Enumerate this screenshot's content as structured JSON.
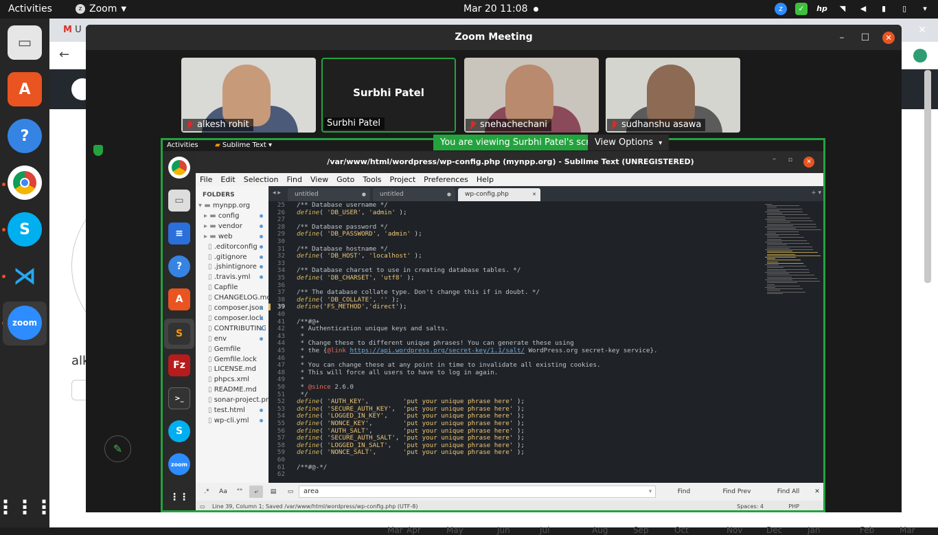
{
  "topbar": {
    "activities": "Activities",
    "app_name": "Zoom",
    "clock": "Mar 20  11:08"
  },
  "browser": {
    "tab_fragment": "U",
    "user_fragment": "alk",
    "calendar_months": [
      "Mar",
      "Apr",
      "May",
      "Jun",
      "Jul",
      "Aug",
      "Sep",
      "Oct",
      "Nov",
      "Dec",
      "Jan",
      "Feb",
      "Mar"
    ]
  },
  "zoom": {
    "title": "Zoom Meeting",
    "participants": [
      {
        "name": "alkesh rohit",
        "muted": true
      },
      {
        "name": "Surbhi Patel",
        "muted": false,
        "active_speaker": true
      },
      {
        "name": "snehachechani",
        "muted": true
      },
      {
        "name": "sudhanshu asawa",
        "muted": true
      }
    ],
    "share_banner": "You are viewing Surbhi Patel's screen",
    "view_options": "View Options"
  },
  "shared_screen": {
    "topbar": {
      "activities": "Activities",
      "app": "Sublime Text"
    },
    "sublime": {
      "title": "/var/www/html/wordpress/wp-config.php (mynpp.org) - Sublime Text (UNREGISTERED)",
      "menu": [
        "File",
        "Edit",
        "Selection",
        "Find",
        "View",
        "Goto",
        "Tools",
        "Project",
        "Preferences",
        "Help"
      ],
      "sidebar_header": "FOLDERS",
      "sidebar_items": [
        {
          "label": "mynpp.org",
          "type": "folder-open"
        },
        {
          "label": "config",
          "type": "folder"
        },
        {
          "label": "vendor",
          "type": "folder"
        },
        {
          "label": "web",
          "type": "folder"
        },
        {
          "label": ".editorconfig",
          "type": "file"
        },
        {
          "label": ".gitignore",
          "type": "file"
        },
        {
          "label": ".jshintignore",
          "type": "file"
        },
        {
          "label": ".travis.yml",
          "type": "file"
        },
        {
          "label": "Capfile",
          "type": "file"
        },
        {
          "label": "CHANGELOG.md",
          "type": "file"
        },
        {
          "label": "composer.json",
          "type": "file"
        },
        {
          "label": "composer.lock",
          "type": "file"
        },
        {
          "label": "CONTRIBUTING.md",
          "type": "file"
        },
        {
          "label": "env",
          "type": "file"
        },
        {
          "label": "Gemfile",
          "type": "file"
        },
        {
          "label": "Gemfile.lock",
          "type": "file"
        },
        {
          "label": "LICENSE.md",
          "type": "file"
        },
        {
          "label": "phpcs.xml",
          "type": "file"
        },
        {
          "label": "README.md",
          "type": "file"
        },
        {
          "label": "sonar-project.properties",
          "type": "file"
        },
        {
          "label": "test.html",
          "type": "file"
        },
        {
          "label": "wp-cli.yml",
          "type": "file"
        }
      ],
      "tabs": [
        {
          "label": "untitled",
          "active": false
        },
        {
          "label": "untitled",
          "active": false
        },
        {
          "label": "wp-config.php",
          "active": true
        }
      ],
      "code_lines": [
        {
          "n": "25",
          "t": "/** Database username */",
          "k": "com"
        },
        {
          "n": "26",
          "t": "define( 'DB_USER', 'admin' );",
          "k": "def"
        },
        {
          "n": "27",
          "t": "",
          "k": "pl"
        },
        {
          "n": "28",
          "t": "/** Database password */",
          "k": "com"
        },
        {
          "n": "29",
          "t": "define( 'DB_PASSWORD', 'admin' );",
          "k": "def"
        },
        {
          "n": "30",
          "t": "",
          "k": "pl"
        },
        {
          "n": "31",
          "t": "/** Database hostname */",
          "k": "com"
        },
        {
          "n": "32",
          "t": "define( 'DB_HOST', 'localhost' );",
          "k": "def"
        },
        {
          "n": "33",
          "t": "",
          "k": "pl"
        },
        {
          "n": "34",
          "t": "/** Database charset to use in creating database tables. */",
          "k": "com"
        },
        {
          "n": "35",
          "t": "define( 'DB_CHARSET', 'utf8' );",
          "k": "def"
        },
        {
          "n": "36",
          "t": "",
          "k": "pl"
        },
        {
          "n": "37",
          "t": "/** The database collate type. Don't change this if in doubt. */",
          "k": "com"
        },
        {
          "n": "38",
          "t": "define( 'DB_COLLATE', '' );",
          "k": "def"
        },
        {
          "n": "39",
          "t": "define('FS_METHOD','direct');",
          "k": "def"
        },
        {
          "n": "40",
          "t": "",
          "k": "pl"
        },
        {
          "n": "41",
          "t": "/**#@+",
          "k": "com"
        },
        {
          "n": "42",
          "t": " * Authentication unique keys and salts.",
          "k": "com"
        },
        {
          "n": "43",
          "t": " *",
          "k": "com"
        },
        {
          "n": "44",
          "t": " * Change these to different unique phrases! You can generate these using",
          "k": "com"
        },
        {
          "n": "45",
          "t": " * the {@link https://api.wordpress.org/secret-key/1.1/salt/ WordPress.org secret-key service}.",
          "k": "link"
        },
        {
          "n": "46",
          "t": " *",
          "k": "com"
        },
        {
          "n": "47",
          "t": " * You can change these at any point in time to invalidate all existing cookies.",
          "k": "com"
        },
        {
          "n": "48",
          "t": " * This will force all users to have to log in again.",
          "k": "com"
        },
        {
          "n": "49",
          "t": " *",
          "k": "com"
        },
        {
          "n": "50",
          "t": " * @since 2.6.0",
          "k": "since"
        },
        {
          "n": "51",
          "t": " */",
          "k": "com"
        },
        {
          "n": "52",
          "t": "define( 'AUTH_KEY',         'put your unique phrase here' );",
          "k": "def"
        },
        {
          "n": "53",
          "t": "define( 'SECURE_AUTH_KEY',  'put your unique phrase here' );",
          "k": "def"
        },
        {
          "n": "54",
          "t": "define( 'LOGGED_IN_KEY',    'put your unique phrase here' );",
          "k": "def"
        },
        {
          "n": "55",
          "t": "define( 'NONCE_KEY',        'put your unique phrase here' );",
          "k": "def"
        },
        {
          "n": "56",
          "t": "define( 'AUTH_SALT',        'put your unique phrase here' );",
          "k": "def"
        },
        {
          "n": "57",
          "t": "define( 'SECURE_AUTH_SALT', 'put your unique phrase here' );",
          "k": "def"
        },
        {
          "n": "58",
          "t": "define( 'LOGGED_IN_SALT',   'put your unique phrase here' );",
          "k": "def"
        },
        {
          "n": "59",
          "t": "define( 'NONCE_SALT',       'put your unique phrase here' );",
          "k": "def"
        },
        {
          "n": "60",
          "t": "",
          "k": "pl"
        },
        {
          "n": "61",
          "t": "/**#@-*/",
          "k": "com"
        },
        {
          "n": "62",
          "t": "",
          "k": "pl"
        }
      ],
      "current_line": "39",
      "find": {
        "regex": ".*",
        "case": "Aa",
        "word": "\"\"",
        "query": "area",
        "find_label": "Find",
        "find_prev_label": "Find Prev",
        "find_all_label": "Find All"
      },
      "status": {
        "left": "Line 39, Column 1; Saved /var/www/html/wordpress/wp-config.php (UTF-8)",
        "spaces": "Spaces: 4",
        "syntax": "PHP"
      }
    }
  },
  "colors": {
    "zoom_green": "#23a33e",
    "ubuntu_orange": "#e95420",
    "zoom_blue": "#2d8cff"
  }
}
